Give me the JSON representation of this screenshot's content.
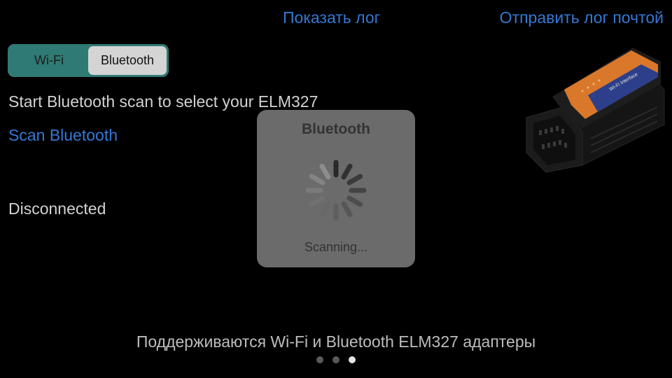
{
  "header": {
    "show_log": "Показать лог",
    "send_log": "Отправить лог почтой"
  },
  "connection_type": {
    "options": [
      "Wi-Fi",
      "Bluetooth"
    ],
    "selected": "Bluetooth"
  },
  "main": {
    "instruction": "Start Bluetooth scan to select your ELM327",
    "scan_link": "Scan Bluetooth",
    "status": "Disconnected"
  },
  "adapter_image": {
    "icon": "obd2-elm327-adapter",
    "label_text": "Wi-Fi Interface",
    "accent_color": "#d9772a"
  },
  "progress_hud": {
    "title": "Bluetooth",
    "message": "Scanning..."
  },
  "footer": {
    "caption": "Поддерживаются Wi-Fi и Bluetooth ELM327 адаптеры"
  },
  "page_indicator": {
    "count": 3,
    "current": 3
  },
  "colors": {
    "background": "#000000",
    "link": "#3478d6",
    "segment_bg": "#2f7a74",
    "hud_bg": "#6b6b6b"
  }
}
